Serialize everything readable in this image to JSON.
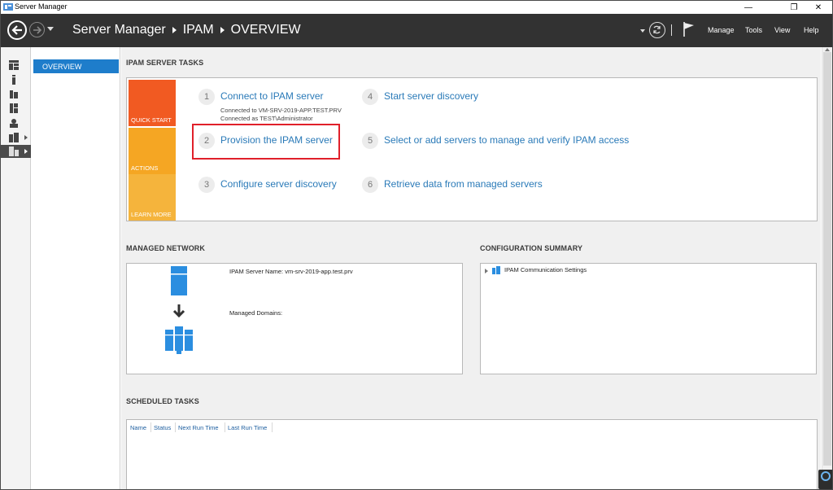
{
  "window": {
    "title": "Server Manager",
    "controls": [
      "—",
      "❐",
      "✕"
    ]
  },
  "header": {
    "breadcrumb": [
      "Server Manager",
      "IPAM",
      "OVERVIEW"
    ],
    "menu": [
      "Manage",
      "Tools",
      "View",
      "Help"
    ]
  },
  "nav": {
    "overview_label": "OVERVIEW"
  },
  "tasks": {
    "title": "IPAM SERVER TASKS",
    "tiles": [
      "QUICK START",
      "ACTIONS",
      "LEARN MORE"
    ],
    "items": [
      {
        "num": "1",
        "label": "Connect to IPAM server"
      },
      {
        "num": "2",
        "label": "Provision the IPAM server"
      },
      {
        "num": "3",
        "label": "Configure server discovery"
      },
      {
        "num": "4",
        "label": "Start server discovery"
      },
      {
        "num": "5",
        "label": "Select or add servers to manage and verify IPAM access"
      },
      {
        "num": "6",
        "label": "Retrieve data from managed servers"
      }
    ],
    "connection_lines": [
      "Connected to VM-SRV-2019-APP.TEST.PRV",
      "Connected as TEST\\Administrator"
    ]
  },
  "managed_network": {
    "title": "MANAGED NETWORK",
    "server_name": "IPAM Server Name: vm-srv-2019-app.test.prv",
    "domains": "Managed Domains:"
  },
  "config_summary": {
    "title": "CONFIGURATION SUMMARY",
    "item": "IPAM Communication Settings"
  },
  "scheduled": {
    "title": "SCHEDULED TASKS",
    "columns": [
      "Name",
      "Status",
      "Next Run Time",
      "Last Run Time"
    ]
  },
  "colors": {
    "header_bg": "#323232",
    "accent_blue": "#1e7dcb",
    "link_blue": "#2a7ab8",
    "quick_start": "#f15a22",
    "actions": "#f5a623",
    "highlight_red": "#e0202a"
  }
}
